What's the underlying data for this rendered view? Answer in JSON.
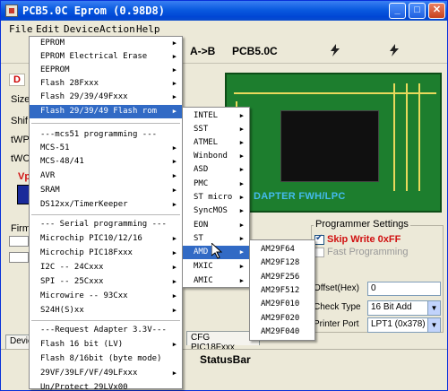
{
  "window": {
    "title": "PCB5.0C Eprom (0.98D8)"
  },
  "menubar": {
    "file": "File",
    "edit": "Edit",
    "device": "Device",
    "action": "Action",
    "help": "Help"
  },
  "toolbar": {
    "a_to_b": "A->B",
    "pcb_label": "PCB5.0C"
  },
  "left_panel": {
    "size": "Size",
    "shift": "Shif",
    "twp": "tWP",
    "twc": "tWC",
    "vp": "Vp",
    "firm": "Firm",
    "d": "D"
  },
  "pcb": {
    "label": "DAPTER FWH/LPC"
  },
  "programmer_settings": {
    "legend": "Programmer Settings",
    "skip_write": "Skip Write 0xFF",
    "fast_programming": "Fast Programming",
    "offset_label": "Offset(Hex)",
    "offset_value": "0",
    "check_type_label": "Check Type",
    "check_type_value": "16 Bit Add",
    "printer_port_label": "Printer Port",
    "printer_port_value": "LPT1 (0x378)"
  },
  "tabs": {
    "device": "Devic",
    "cfg": "CFG PIC18Fxxx"
  },
  "statusbar": {
    "text": "StatusBar"
  },
  "device_menu": {
    "items": [
      "EPROM",
      "EPROM Electrical Erase",
      "EEPROM",
      "Flash 28Fxxx",
      "Flash 29/39/49Fxxx",
      "Flash 29/39/49 Flash rom",
      "---mcs51 programming ---",
      "MCS-51",
      "MCS-48/41",
      "AVR",
      "SRAM",
      "DS12xx/TimerKeeper",
      "--- Serial programming ---",
      "Microchip PIC10/12/16",
      "Microchip PIC18Fxxx",
      "I2C -- 24Cxxx",
      "SPI -- 25Cxxx",
      "Microwire -- 93Cxx",
      "S24H(S)xx",
      "---Request Adapter 3.3V---",
      "Flash 16 bit (LV)",
      "Flash 8/16bit (byte mode)",
      "29VF/39LF/VF/49LFxxx",
      "Un/Protect 29LVx00"
    ]
  },
  "maker_menu": {
    "items": [
      "INTEL",
      "SST",
      "ATMEL",
      "Winbond",
      "ASD",
      "PMC",
      "ST micro",
      "SyncMOS",
      "EON",
      "ST",
      "AMD",
      "MXIC",
      "AMIC"
    ]
  },
  "chip_menu": {
    "items": [
      "AM29F64",
      "AM29F128",
      "AM29F256",
      "AM29F512",
      "AM29F010",
      "AM29F020",
      "AM29F040"
    ]
  },
  "colors": {
    "title_blue": "#0a5adf",
    "menu_highlight": "#316ac5",
    "pcb_green": "#1d7e2e",
    "red_text": "#d01010"
  }
}
